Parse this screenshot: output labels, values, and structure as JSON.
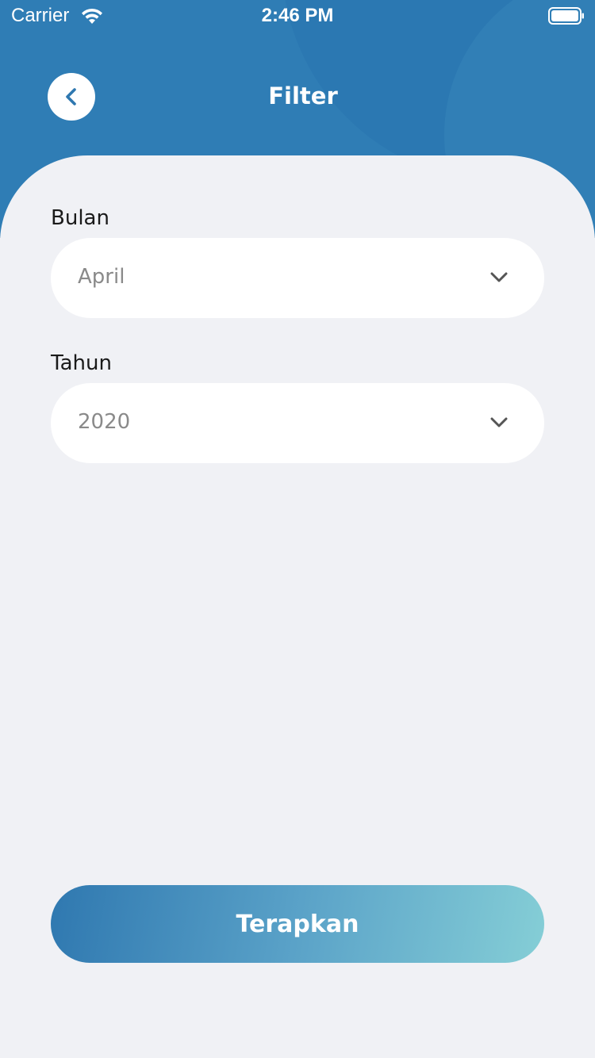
{
  "status_bar": {
    "carrier": "Carrier",
    "time": "2:46 PM",
    "wifi_icon": "wifi-icon",
    "battery_icon": "battery-icon"
  },
  "header": {
    "title": "Filter",
    "back_icon": "chevron-left-icon",
    "color": "#2f7db5"
  },
  "form": {
    "month": {
      "label": "Bulan",
      "value": "April",
      "icon": "chevron-down-icon"
    },
    "year": {
      "label": "Tahun",
      "value": "2020",
      "icon": "chevron-down-icon"
    }
  },
  "apply_button": {
    "label": "Terapkan",
    "gradient_start": "#2f78b0",
    "gradient_end": "#85ced6"
  }
}
